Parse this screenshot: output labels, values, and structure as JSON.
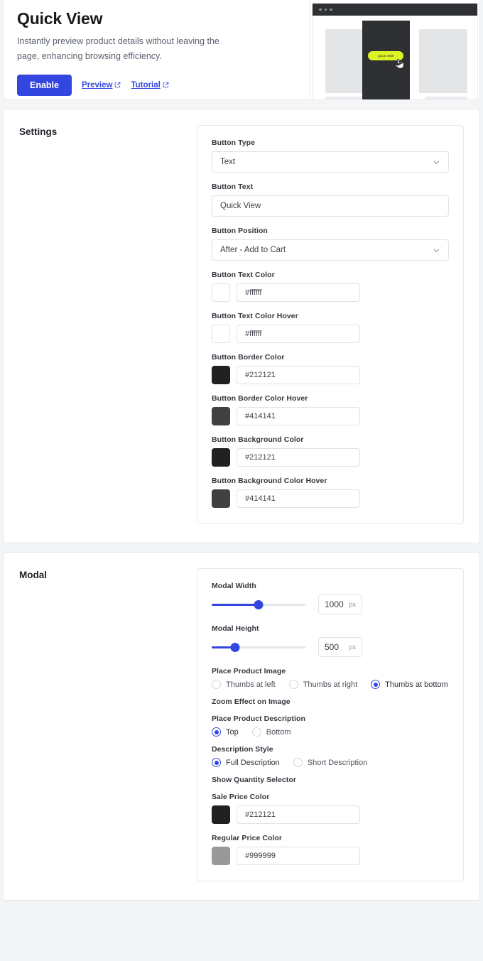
{
  "header": {
    "title": "Quick View",
    "description": "Instantly preview product details without leaving the page, enhancing browsing efficiency.",
    "enable_label": "Enable",
    "preview_label": "Preview",
    "tutorial_label": "Tutorial",
    "accent_color": "#3347e0"
  },
  "preview_mock": {
    "button_text": "QUICK VIEW",
    "button_color": "#ddf326",
    "card_color": "#2f3034"
  },
  "settings": {
    "title": "Settings",
    "button_type": {
      "label": "Button Type",
      "value": "Text"
    },
    "button_text": {
      "label": "Button Text",
      "value": "Quick View"
    },
    "button_position": {
      "label": "Button Position",
      "value": "After - Add to Cart"
    },
    "colors": [
      {
        "label": "Button Text Color",
        "value": "#ffffff"
      },
      {
        "label": "Button Text Color Hover",
        "value": "#ffffff"
      },
      {
        "label": "Button Border Color",
        "value": "#212121"
      },
      {
        "label": "Button Border Color Hover",
        "value": "#414141"
      },
      {
        "label": "Button Background Color",
        "value": "#212121"
      },
      {
        "label": "Button Background Color Hover",
        "value": "#414141"
      }
    ]
  },
  "modal": {
    "title": "Modal",
    "modal_width": {
      "label": "Modal Width",
      "value": "1000",
      "unit": "px",
      "percent": 50
    },
    "modal_height": {
      "label": "Modal Height",
      "value": "500",
      "unit": "px",
      "percent": 25
    },
    "place_product_image": {
      "label": "Place Product Image",
      "options": [
        {
          "label": "Thumbs at left",
          "checked": false
        },
        {
          "label": "Thumbs at right",
          "checked": false
        },
        {
          "label": "Thumbs at bottom",
          "checked": true
        }
      ]
    },
    "zoom_effect": {
      "label": "Zoom Effect on Image",
      "on": true
    },
    "place_product_description": {
      "label": "Place Product Description",
      "options": [
        {
          "label": "Top",
          "checked": true
        },
        {
          "label": "Bottom",
          "checked": false
        }
      ]
    },
    "description_style": {
      "label": "Description Style",
      "options": [
        {
          "label": "Full Description",
          "checked": true
        },
        {
          "label": "Short Description",
          "checked": false
        }
      ]
    },
    "show_quantity_selector": {
      "label": "Show Quantity Selector",
      "on": true
    },
    "colors": [
      {
        "label": "Sale Price Color",
        "value": "#212121"
      },
      {
        "label": "Regular Price Color",
        "value": "#999999"
      }
    ]
  }
}
